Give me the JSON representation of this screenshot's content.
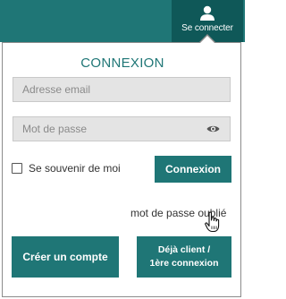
{
  "header": {
    "account_label": "Se connecter",
    "account_icon": "user-icon"
  },
  "login": {
    "title": "CONNEXION",
    "email_placeholder": "Adresse email",
    "password_placeholder": "Mot de passe",
    "show_password_icon": "eye-icon",
    "remember_label": "Se souvenir de moi",
    "submit_label": "Connexion",
    "forgot_label": "mot de passe oublié",
    "create_label": "Créer un compte",
    "existing_line1": "Déjà client /",
    "existing_line2": "1ère connexion"
  },
  "colors": {
    "brand": "#1f7676",
    "brand_dark": "#0f5858",
    "field_bg": "#e4e4e4"
  }
}
